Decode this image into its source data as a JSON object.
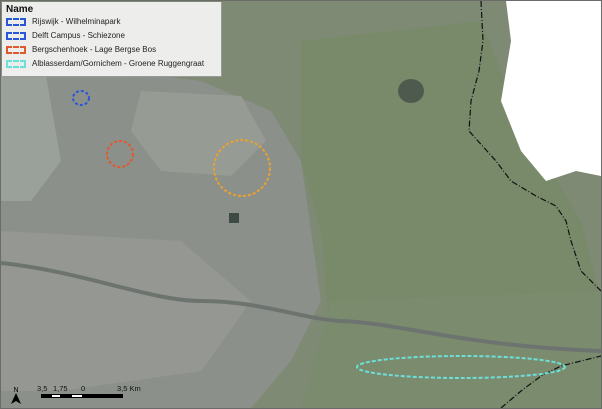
{
  "legend": {
    "title": "Name",
    "items": [
      {
        "label": "Rijswijk - Wilhelminapark",
        "color": "#2a56d8"
      },
      {
        "label": "Delft Campus - Schiezone",
        "color": "#2a56d8"
      },
      {
        "label": "Bergschenhoek - Lage Bergse Bos",
        "color": "#e0592e"
      },
      {
        "label": "Alblasserdam/Gornichem - Groene Ruggengraat",
        "color": "#6ce0d8"
      }
    ]
  },
  "study_areas": [
    {
      "name": "Delft Campus - Schiezone",
      "color": "#2a56d8"
    },
    {
      "name": "Rijswijk - Wilhelminapark",
      "color": "#e0592e"
    },
    {
      "name": "Bergschenhoek - Lage Bergse Bos",
      "color": "#eaa12f"
    },
    {
      "name": "Alblasserdam/Gornichem - Groene Ruggengraat",
      "color": "#6ce0d8"
    }
  ],
  "scale": {
    "labels": [
      "3,5",
      "1,75",
      "0",
      "3,5 Km"
    ]
  },
  "north_arrow": {
    "label": "N"
  },
  "colors": {
    "urban": "#8f938c",
    "rural": "#7c8a6e",
    "outside_area": "#ffffff",
    "boundary_line": "#111111"
  }
}
